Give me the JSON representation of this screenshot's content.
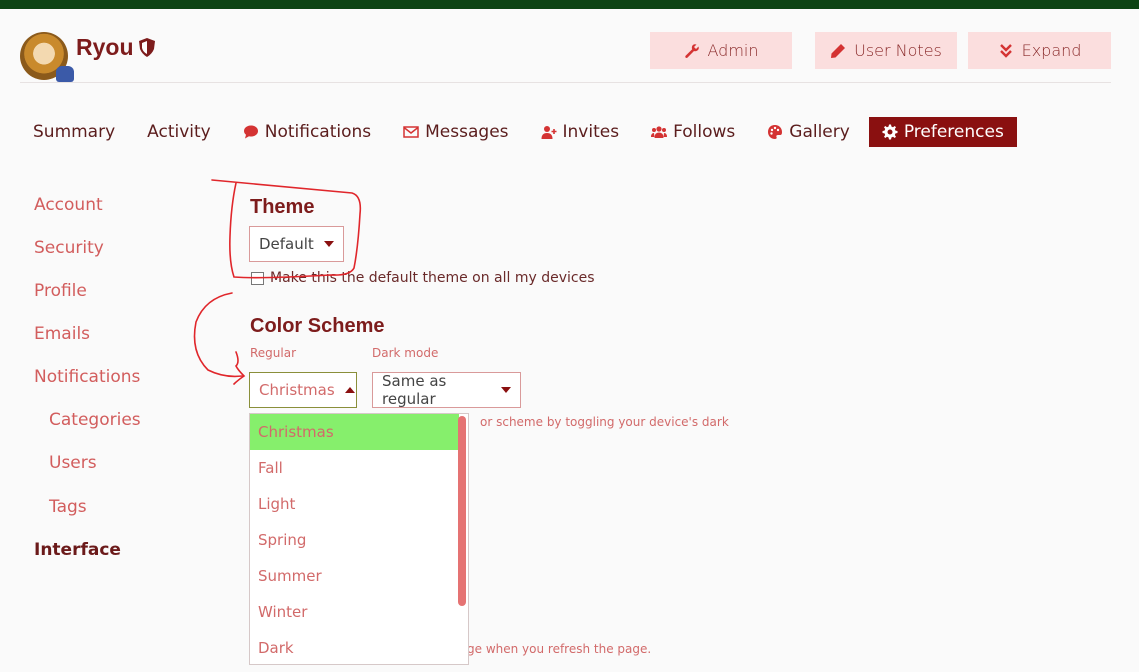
{
  "header": {
    "username": "Ryou",
    "buttons": {
      "admin": "Admin",
      "user_notes": "User Notes",
      "expand": "Expand"
    }
  },
  "tabs": [
    {
      "label": "Summary",
      "icon": ""
    },
    {
      "label": "Activity",
      "icon": ""
    },
    {
      "label": "Notifications",
      "icon": "comment-icon"
    },
    {
      "label": "Messages",
      "icon": "envelope-icon"
    },
    {
      "label": "Invites",
      "icon": "user-plus-icon"
    },
    {
      "label": "Follows",
      "icon": "users-icon"
    },
    {
      "label": "Gallery",
      "icon": "palette-icon"
    },
    {
      "label": "Preferences",
      "icon": "gear-icon",
      "active": true
    }
  ],
  "sidebar": {
    "items": [
      {
        "label": "Account"
      },
      {
        "label": "Security"
      },
      {
        "label": "Profile"
      },
      {
        "label": "Emails"
      },
      {
        "label": "Notifications"
      },
      {
        "label": "Categories"
      },
      {
        "label": "Users"
      },
      {
        "label": "Tags"
      },
      {
        "label": "Interface",
        "active": true
      }
    ]
  },
  "theme": {
    "heading": "Theme",
    "selected": "Default",
    "default_checkbox_label": "Make this the default theme on all my devices"
  },
  "color_scheme": {
    "heading": "Color Scheme",
    "regular_label": "Regular",
    "regular_selected": "Christmas",
    "dark_label": "Dark mode",
    "dark_selected": "Same as regular",
    "hint_partial": "or scheme by toggling your device's dark",
    "bottom_hint_partial": "ge when you refresh the page.",
    "options": [
      "Christmas",
      "Fall",
      "Light",
      "Spring",
      "Summer",
      "Winter",
      "Dark"
    ]
  },
  "colors": {
    "top_bar": "#0d4414",
    "accent": "#8a1010",
    "button_bg": "#fbdede",
    "selected_option": "#86ef6c",
    "annotation": "#e0262b"
  }
}
